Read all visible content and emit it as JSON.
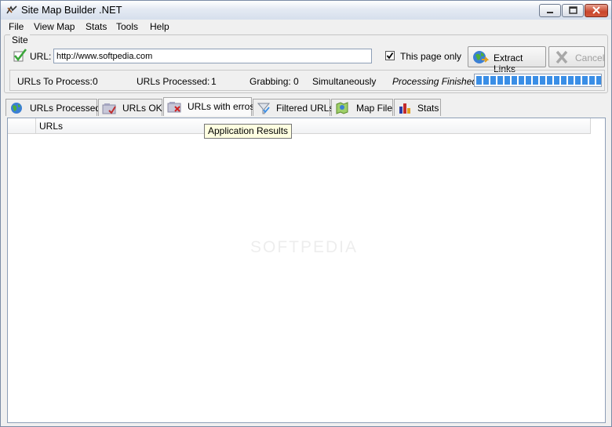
{
  "window": {
    "title": "Site Map Builder .NET"
  },
  "menu": [
    "File",
    "View Map",
    "Stats",
    "Tools",
    "Help"
  ],
  "site": {
    "legend": "Site",
    "url_label": "URL:",
    "url_value": "http://www.softpedia.com",
    "this_page_only_label": "This page only",
    "this_page_only_checked": true,
    "extract_label": "Extract Links",
    "cancel_label": "Cancel"
  },
  "status": {
    "to_process_label": "URLs To Process:",
    "to_process_value": "0",
    "processed_label": "URLs Processed:",
    "processed_value": "1",
    "grabbing_label": "Grabbing:",
    "grabbing_value": "0",
    "simultaneously_label": "Simultaneously",
    "state": "Processing Finished",
    "progress": 1.0
  },
  "tabs": [
    {
      "label": "URLs Processed",
      "icon": "globe-icon"
    },
    {
      "label": "URLs OK",
      "icon": "check-folder-icon"
    },
    {
      "label": "URLs with erros",
      "icon": "error-folder-icon"
    },
    {
      "label": "Filtered URLs",
      "icon": "filter-icon"
    },
    {
      "label": "Map File",
      "icon": "map-icon"
    },
    {
      "label": "Stats",
      "icon": "bar-chart-icon"
    }
  ],
  "active_tab_index": 2,
  "grid": {
    "columns": [
      "URLs"
    ]
  },
  "tooltip": "Application Results",
  "watermark": "SOFTPEDIA",
  "colors": {
    "progress": "#3a8ee6",
    "tooltip_bg": "#ffffe1",
    "close_button": "#c9462c"
  }
}
